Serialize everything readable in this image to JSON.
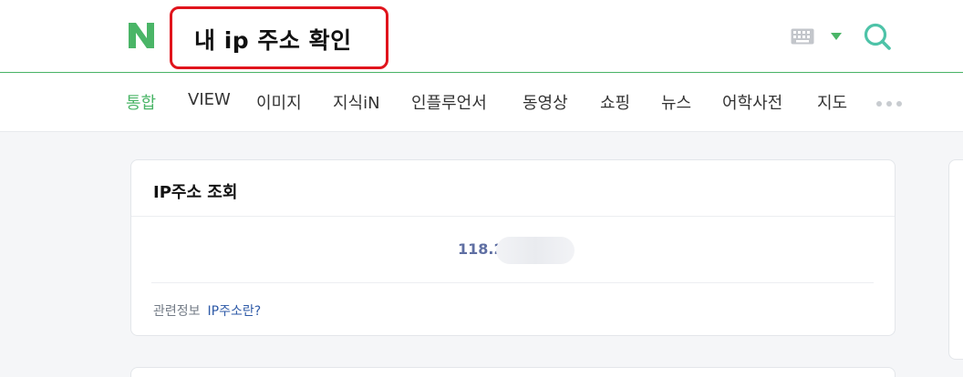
{
  "header": {
    "search_query": "내 ip 주소 확인",
    "logo_icon": "naver-n-logo",
    "keyboard_icon": "keyboard-icon",
    "dropdown_icon": "triangle-down-icon",
    "search_icon": "search-icon",
    "brand_color": "#4ab567",
    "highlight_color": "#e0141c"
  },
  "nav": {
    "tabs": [
      {
        "label": "통합",
        "active": true
      },
      {
        "label": "VIEW"
      },
      {
        "label": "이미지"
      },
      {
        "label": "지식iN"
      },
      {
        "label": "인플루언서"
      },
      {
        "label": "동영상"
      },
      {
        "label": "쇼핑"
      },
      {
        "label": "뉴스"
      },
      {
        "label": "어학사전"
      },
      {
        "label": "지도"
      }
    ],
    "more_icon": "more-dots-icon"
  },
  "ip_card": {
    "title": "IP주소 조회",
    "ip_visible": "118.2",
    "ip_text_color": "#5f6fa3",
    "related_label": "관련정보",
    "related_link": "IP주소란?"
  }
}
